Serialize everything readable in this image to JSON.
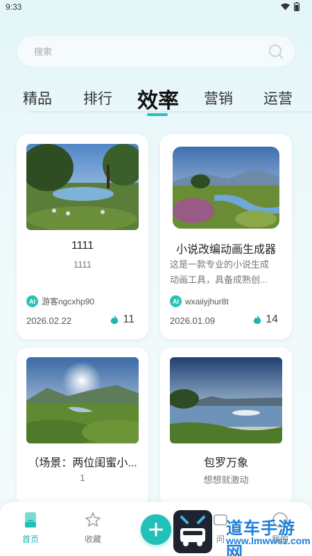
{
  "status": {
    "time": "9:33"
  },
  "search": {
    "placeholder": "搜索"
  },
  "tabs": [
    {
      "label": "精品"
    },
    {
      "label": "排行"
    },
    {
      "label": "效率"
    },
    {
      "label": "营销"
    },
    {
      "label": "运营"
    }
  ],
  "active_tab": "效率",
  "cards": [
    {
      "title": "1111",
      "description": "1111",
      "author": "游客ngcxhp90",
      "date": "2026.02.22",
      "likes": "11"
    },
    {
      "title": "小说改编动画生成器",
      "description_line1": "这是一款专业的小说生成",
      "description_line2": "动画工具，具备成熟创...",
      "author": "wxaiiyjhur8t",
      "date": "2026.01.09",
      "likes": "14"
    },
    {
      "title": "（场景：两位闺蜜小...",
      "description": "1"
    },
    {
      "title": "包罗万象",
      "description": "想想就激动"
    }
  ],
  "author_badge": "AI",
  "nav": {
    "home": "首页",
    "favorites": "收藏",
    "messages_partial": "问",
    "mine_partial": "我的"
  },
  "watermark": {
    "line1": "道车手游网",
    "line2": "www.lmwwsz.com"
  },
  "colors": {
    "accent": "#22c0b8",
    "watermark": "#1e7fd8",
    "flame": "#1fb5ad"
  }
}
